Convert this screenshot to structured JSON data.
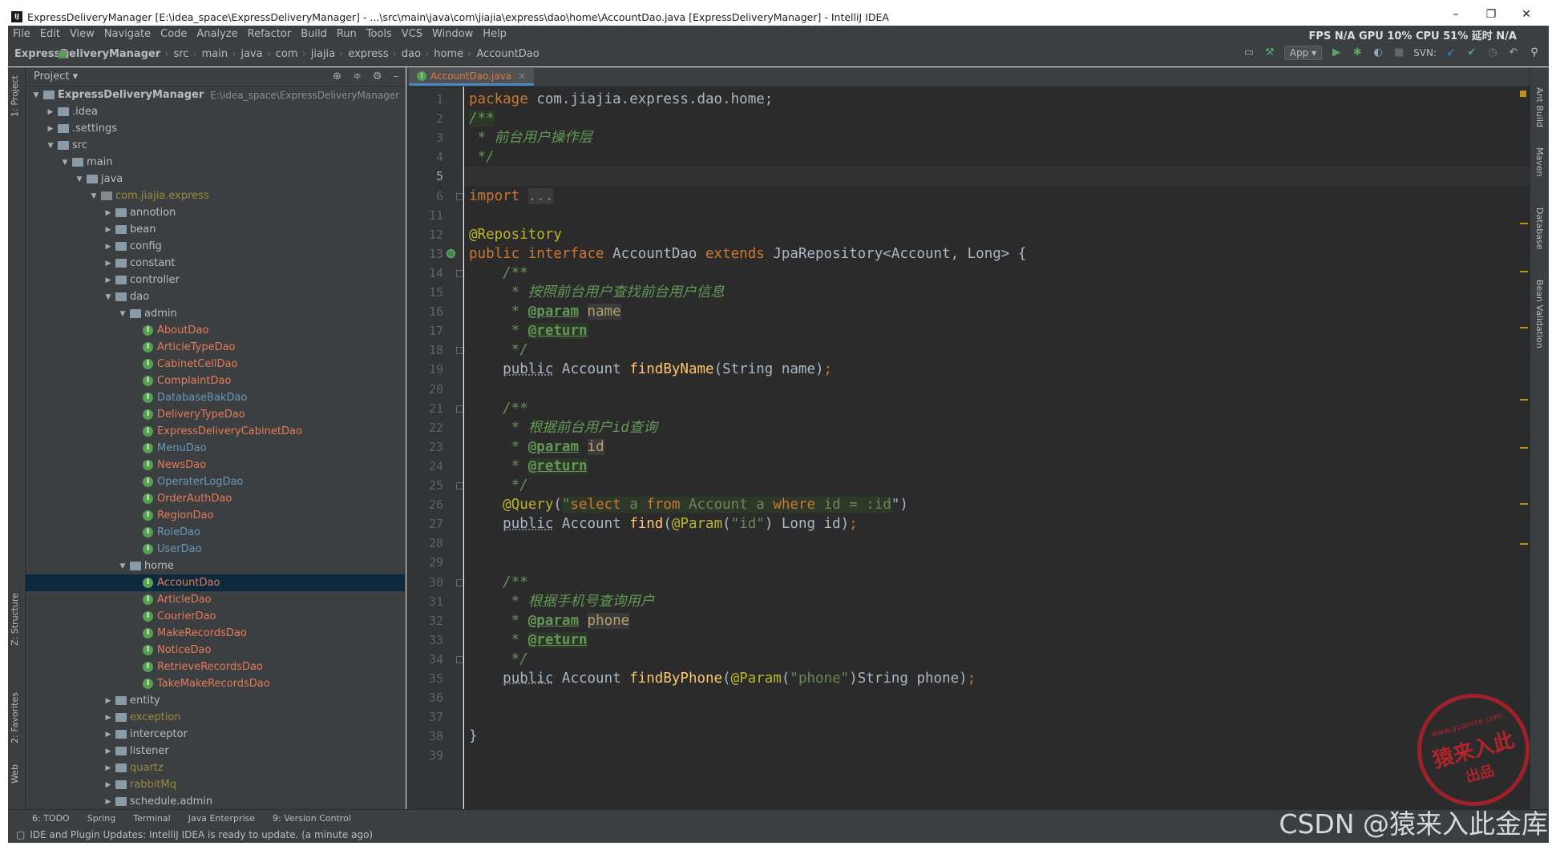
{
  "titlebar": {
    "text": "ExpressDeliveryManager [E:\\idea_space\\ExpressDeliveryManager] - ...\\src\\main\\java\\com\\jiajia\\express\\dao\\home\\AccountDao.java [ExpressDeliveryManager] - IntelliJ IDEA",
    "minimize": "–",
    "maximize": "❐",
    "close": "✕"
  },
  "menu": [
    "File",
    "Edit",
    "View",
    "Navigate",
    "Code",
    "Analyze",
    "Refactor",
    "Build",
    "Run",
    "Tools",
    "VCS",
    "Window",
    "Help"
  ],
  "fps": "FPS N/A GPU 10% CPU 51% 延时 N/A",
  "breadcrumbs": [
    "ExpressDeliveryManager",
    "src",
    "main",
    "java",
    "com",
    "jiajia",
    "express",
    "dao",
    "home",
    "AccountDao"
  ],
  "toolbar": {
    "run_config": "App ▾",
    "svn": "SVN:"
  },
  "project": {
    "header": "Project ▾",
    "rows": [
      {
        "text": "ExpressDeliveryManager",
        "path": "E:\\idea_space\\ExpressDeliveryManager",
        "indent": 0,
        "arrow": "▼",
        "type": "root"
      },
      {
        "text": ".idea",
        "indent": 1,
        "arrow": "▶",
        "type": "folder"
      },
      {
        "text": ".settings",
        "indent": 1,
        "arrow": "▶",
        "type": "folder"
      },
      {
        "text": "src",
        "indent": 1,
        "arrow": "▼",
        "type": "folder"
      },
      {
        "text": "main",
        "indent": 2,
        "arrow": "▼",
        "type": "folder"
      },
      {
        "text": "java",
        "indent": 3,
        "arrow": "▼",
        "type": "folder"
      },
      {
        "text": "com.jiajia.express",
        "indent": 4,
        "arrow": "▼",
        "type": "pkg",
        "color": "olive"
      },
      {
        "text": "annotion",
        "indent": 5,
        "arrow": "▶",
        "type": "folder"
      },
      {
        "text": "bean",
        "indent": 5,
        "arrow": "▶",
        "type": "folder"
      },
      {
        "text": "config",
        "indent": 5,
        "arrow": "▶",
        "type": "folder"
      },
      {
        "text": "constant",
        "indent": 5,
        "arrow": "▶",
        "type": "folder"
      },
      {
        "text": "controller",
        "indent": 5,
        "arrow": "▶",
        "type": "folder"
      },
      {
        "text": "dao",
        "indent": 5,
        "arrow": "▼",
        "type": "folder"
      },
      {
        "text": "admin",
        "indent": 6,
        "arrow": "▼",
        "type": "folder"
      },
      {
        "text": "AboutDao",
        "indent": 7,
        "type": "iface",
        "color": "red"
      },
      {
        "text": "ArticleTypeDao",
        "indent": 7,
        "type": "iface",
        "color": "red"
      },
      {
        "text": "CabinetCellDao",
        "indent": 7,
        "type": "iface",
        "color": "red"
      },
      {
        "text": "ComplaintDao",
        "indent": 7,
        "type": "iface",
        "color": "red"
      },
      {
        "text": "DatabaseBakDao",
        "indent": 7,
        "type": "iface",
        "color": "blue"
      },
      {
        "text": "DeliveryTypeDao",
        "indent": 7,
        "type": "iface",
        "color": "red"
      },
      {
        "text": "ExpressDeliveryCabinetDao",
        "indent": 7,
        "type": "iface",
        "color": "red"
      },
      {
        "text": "MenuDao",
        "indent": 7,
        "type": "iface",
        "color": "blue"
      },
      {
        "text": "NewsDao",
        "indent": 7,
        "type": "iface",
        "color": "red"
      },
      {
        "text": "OperaterLogDao",
        "indent": 7,
        "type": "iface",
        "color": "blue"
      },
      {
        "text": "OrderAuthDao",
        "indent": 7,
        "type": "iface",
        "color": "red"
      },
      {
        "text": "RegionDao",
        "indent": 7,
        "type": "iface",
        "color": "red"
      },
      {
        "text": "RoleDao",
        "indent": 7,
        "type": "iface",
        "color": "blue"
      },
      {
        "text": "UserDao",
        "indent": 7,
        "type": "iface",
        "color": "blue"
      },
      {
        "text": "home",
        "indent": 6,
        "arrow": "▼",
        "type": "folder"
      },
      {
        "text": "AccountDao",
        "indent": 7,
        "type": "iface",
        "color": "red",
        "selected": true
      },
      {
        "text": "ArticleDao",
        "indent": 7,
        "type": "iface",
        "color": "red"
      },
      {
        "text": "CourierDao",
        "indent": 7,
        "type": "iface",
        "color": "red"
      },
      {
        "text": "MakeRecordsDao",
        "indent": 7,
        "type": "iface",
        "color": "red"
      },
      {
        "text": "NoticeDao",
        "indent": 7,
        "type": "iface",
        "color": "red"
      },
      {
        "text": "RetrieveRecordsDao",
        "indent": 7,
        "type": "iface",
        "color": "red"
      },
      {
        "text": "TakeMakeRecordsDao",
        "indent": 7,
        "type": "iface",
        "color": "red"
      },
      {
        "text": "entity",
        "indent": 5,
        "arrow": "▶",
        "type": "folder"
      },
      {
        "text": "exception",
        "indent": 5,
        "arrow": "▶",
        "type": "folder",
        "color": "olive"
      },
      {
        "text": "interceptor",
        "indent": 5,
        "arrow": "▶",
        "type": "folder"
      },
      {
        "text": "listener",
        "indent": 5,
        "arrow": "▶",
        "type": "folder"
      },
      {
        "text": "quartz",
        "indent": 5,
        "arrow": "▶",
        "type": "folder",
        "color": "olive"
      },
      {
        "text": "rabbitMq",
        "indent": 5,
        "arrow": "▶",
        "type": "folder",
        "color": "olive"
      },
      {
        "text": "schedule.admin",
        "indent": 5,
        "arrow": "▶",
        "type": "folder"
      }
    ]
  },
  "editor_tab": {
    "label": "AccountDao.java",
    "close": "×"
  },
  "code": [
    {
      "n": "1",
      "html": "<span class='kw'>package</span> com.jiajia.express.dao.home;"
    },
    {
      "n": "2",
      "html": "<span class='cm hl'>/**</span>"
    },
    {
      "n": "3",
      "html": "<span class='cm'> * 前台用户操作层</span>"
    },
    {
      "n": "4",
      "html": "<span class='cm'> */</span>"
    },
    {
      "n": "5",
      "html": ""
    },
    {
      "n": "6",
      "html": "<span class='kw'>import</span> <span style='background:#3a3a3a;color:#808080'>...</span>"
    },
    {
      "n": "11",
      "html": ""
    },
    {
      "n": "12",
      "html": "<span class='ann'>@Repository</span>"
    },
    {
      "n": "13",
      "html": "<span class='kw'>public interface</span> AccountDao <span class='kw'>extends</span> JpaRepository&lt;Account, Long&gt; {"
    },
    {
      "n": "14",
      "html": "    <span class='cm'>/**</span>"
    },
    {
      "n": "15",
      "html": "<span class='cm'>     * 按照前台用户查找前台用户信息</span>"
    },
    {
      "n": "16",
      "html": "<span class='cm'>     * </span><span class='tag'>@param</span> <span class='par'>name</span>"
    },
    {
      "n": "17",
      "html": "<span class='cm'>     * </span><span class='tag hl'>@return</span>"
    },
    {
      "n": "18",
      "html": "<span class='cm'>     */</span>"
    },
    {
      "n": "19",
      "html": "    <span class='und'>public</span> Account <span class='fn'>findByName</span>(String name)<span class='kw'>;</span>"
    },
    {
      "n": "20",
      "html": ""
    },
    {
      "n": "21",
      "html": "    <span class='cm'>/**</span>"
    },
    {
      "n": "22",
      "html": "<span class='cm'>     * 根据前台用户id查询</span>"
    },
    {
      "n": "23",
      "html": "<span class='cm'>     * </span><span class='tag'>@param</span> <span class='par'>id</span>"
    },
    {
      "n": "24",
      "html": "<span class='cm'>     * </span><span class='tag hl'>@return</span>"
    },
    {
      "n": "25",
      "html": "<span class='cm'>     */</span>"
    },
    {
      "n": "26",
      "html": "    <span class='ann'>@Query</span>(<span class='str hl'>\"<span class='kw'>select</span> a <span class='kw'>from</span> Account a <span class='kw'>where</span> id = :id</span>\")"
    },
    {
      "n": "27",
      "html": "    <span class='und'>public</span> Account <span class='fn'>find</span>(<span class='ann'>@Param</span>(<span class='str'>\"id\"</span>) Long id)<span class='kw'>;</span>"
    },
    {
      "n": "28",
      "html": ""
    },
    {
      "n": "29",
      "html": ""
    },
    {
      "n": "30",
      "html": "    <span class='cm'>/**</span>"
    },
    {
      "n": "31",
      "html": "<span class='cm'>     * 根据手机号查询用户</span>"
    },
    {
      "n": "32",
      "html": "<span class='cm'>     * </span><span class='tag'>@param</span> <span class='par'>phone</span>"
    },
    {
      "n": "33",
      "html": "<span class='cm'>     * </span><span class='tag hl'>@return</span>"
    },
    {
      "n": "34",
      "html": "<span class='cm'>     */</span>"
    },
    {
      "n": "35",
      "html": "    <span class='und'>public</span> Account <span class='fn'>findByPhone</span>(<span class='ann'>@Param</span>(<span class='str'>\"phone\"</span>)String phone)<span class='kw'>;</span>"
    },
    {
      "n": "36",
      "html": ""
    },
    {
      "n": "37",
      "html": ""
    },
    {
      "n": "38",
      "html": "}"
    },
    {
      "n": "39",
      "html": ""
    }
  ],
  "left_tabs": [
    "1: Project",
    "Z: Structure",
    "2: Favorites",
    "Web"
  ],
  "right_tabs": [
    "Ant Build",
    "Maven",
    "Database",
    "Bean Validation"
  ],
  "bottom_tabs": [
    "6: TODO",
    "Spring",
    "Terminal",
    "Java Enterprise",
    "9: Version Control"
  ],
  "status": "IDE and Plugin Updates: IntelliJ IDEA is ready to update. (a minute ago)",
  "watermark": "CSDN @猿来入此金库",
  "stamp": {
    "url": "www.yuanrce.com",
    "name": "猿来入此",
    "sub": "出品"
  }
}
